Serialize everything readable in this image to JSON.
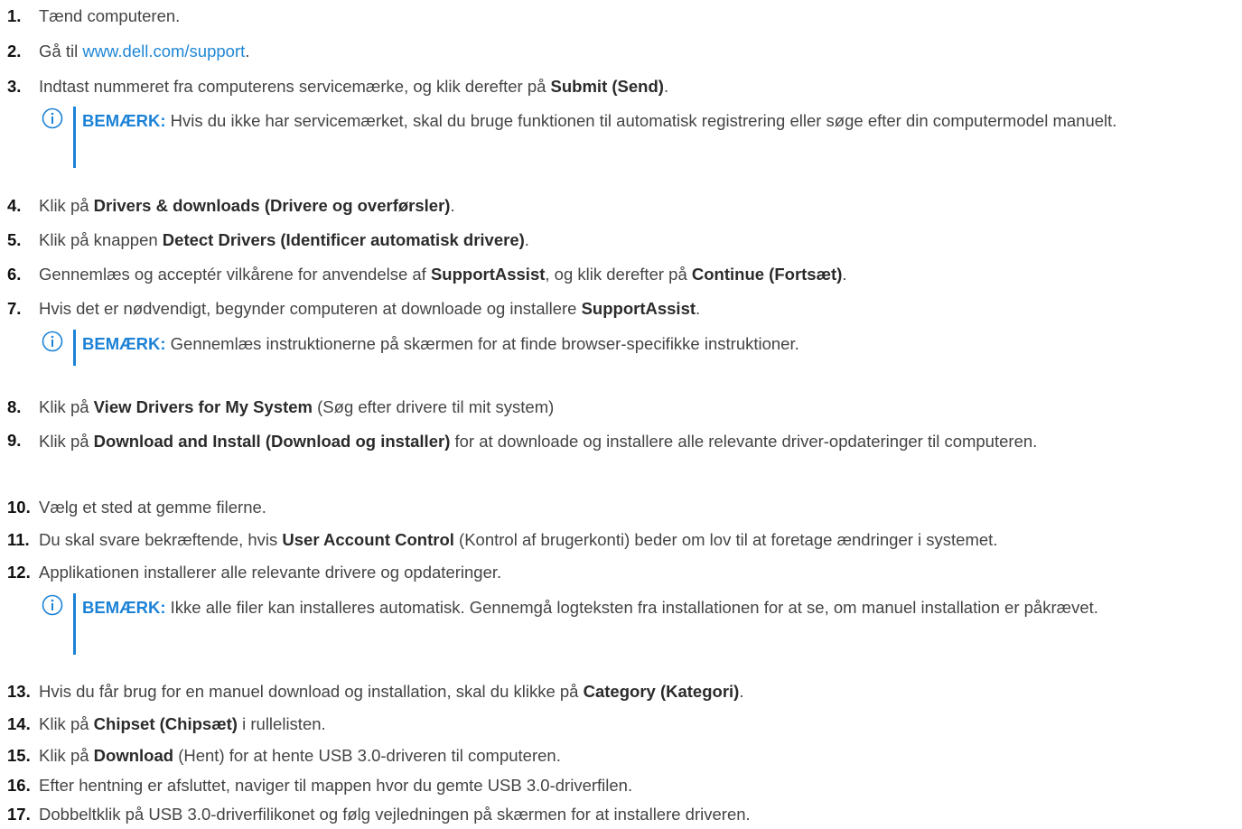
{
  "steps": [
    {
      "num": "1.",
      "pre": "Tænd computeren."
    },
    {
      "num": "2.",
      "pre": "Gå til ",
      "link": "www.dell.com/support",
      "post": "."
    },
    {
      "num": "3.",
      "pre": "Indtast nummeret fra computerens servicemærke, og klik derefter på ",
      "bold": "Submit (Send)",
      "post": "."
    },
    {
      "num": "4.",
      "pre": "Klik på ",
      "bold": "Drivers & downloads (Drivere og overførsler)",
      "post": "."
    },
    {
      "num": "5.",
      "pre": "Klik på knappen ",
      "bold": "Detect Drivers (Identificer automatisk drivere)",
      "post": "."
    },
    {
      "num": "6.",
      "pre": "Gennemlæs og acceptér vilkårene for anvendelse af ",
      "bold": "SupportAssist",
      "mid": ", og klik derefter på ",
      "bold2": "Continue (Fortsæt)",
      "post": "."
    },
    {
      "num": "7.",
      "pre": "Hvis det er nødvendigt, begynder computeren at downloade og installere ",
      "bold": "SupportAssist",
      "post": "."
    },
    {
      "num": "8.",
      "pre": "Klik på ",
      "bold": "View Drivers for My System",
      "post": " (Søg efter drivere til mit system)"
    },
    {
      "num": "9.",
      "pre": "Klik på ",
      "bold": "Download and Install (Download og installer)",
      "post": " for at downloade og installere alle relevante driver-opdateringer til computeren."
    },
    {
      "num": "10.",
      "pre": "Vælg et sted at gemme filerne."
    },
    {
      "num": "11.",
      "pre": "Du skal svare bekræftende, hvis ",
      "bold": "User Account Control",
      "post": " (Kontrol af brugerkonti) beder om lov til at foretage ændringer i systemet."
    },
    {
      "num": "12.",
      "pre": "Applikationen installerer alle relevante drivere og opdateringer."
    },
    {
      "num": "13.",
      "pre": "Hvis du får brug for en manuel download og installation, skal du klikke på ",
      "bold": "Category (Kategori)",
      "post": "."
    },
    {
      "num": "14.",
      "pre": "Klik på ",
      "bold": "Chipset (Chipsæt)",
      "post": " i rullelisten."
    },
    {
      "num": "15.",
      "pre": "Klik på ",
      "bold": "Download",
      "post": " (Hent) for at hente USB 3.0-driveren til computeren."
    },
    {
      "num": "16.",
      "pre": "Efter hentning er afsluttet, naviger til mappen hvor du gemte USB 3.0-driverfilen."
    },
    {
      "num": "17.",
      "pre": "Dobbeltklik på USB 3.0-driverfilikonet og følg vejledningen på skærmen for at installere driveren."
    }
  ],
  "notes": [
    {
      "label": "BEMÆRK:",
      "text": " Hvis du ikke har servicemærket, skal du bruge funktionen til automatisk registrering eller søge efter din computermodel manuelt."
    },
    {
      "label": "BEMÆRK:",
      "text": " Gennemlæs instruktionerne på skærmen for at finde browser-specifikke instruktioner."
    },
    {
      "label": "BEMÆRK:",
      "text": " Ikke alle filer kan installeres automatisk. Gennemgå logteksten fra installationen for at se, om manuel installation er påkrævet."
    }
  ],
  "colors": {
    "note_accent": "#1c82d6",
    "link": "#1f87d5"
  },
  "icons": {
    "note": "info-circle-icon"
  }
}
